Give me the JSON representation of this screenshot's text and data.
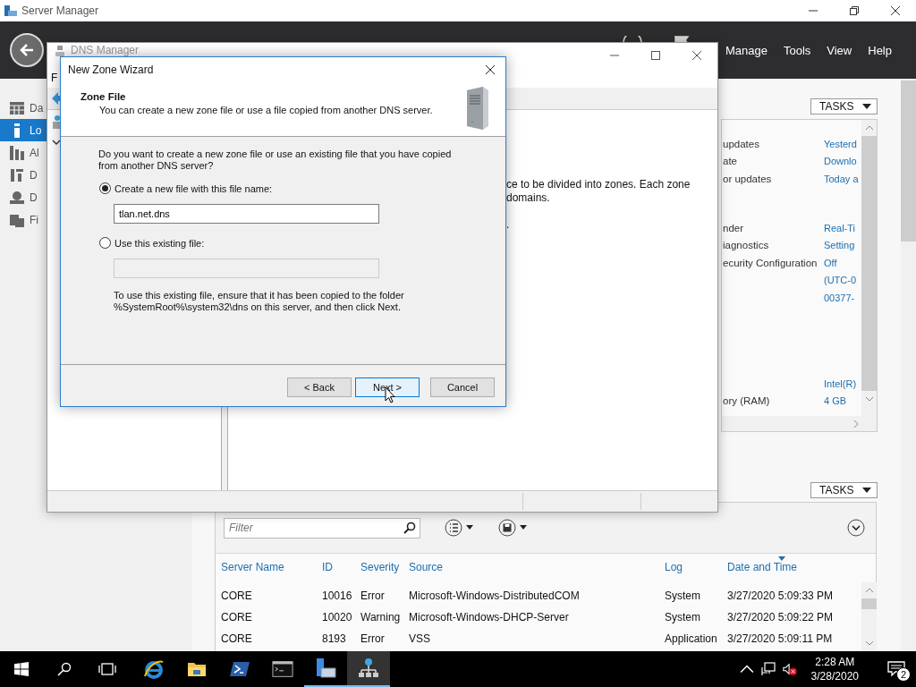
{
  "server_manager": {
    "title": "Server Manager",
    "menu": [
      "Manage",
      "Tools",
      "View",
      "Help"
    ],
    "nav": [
      {
        "kind": "dashboard",
        "label": "Da",
        "selected": false
      },
      {
        "kind": "local",
        "label": "Lo",
        "selected": true
      },
      {
        "kind": "all",
        "label": "Al",
        "selected": false
      },
      {
        "kind": "dhcp",
        "label": "D",
        "selected": false
      },
      {
        "kind": "dns",
        "label": "D",
        "selected": false
      },
      {
        "kind": "files",
        "label": "Fi",
        "selected": false
      }
    ],
    "properties": {
      "tasks_label": "TASKS",
      "groups": [
        [
          {
            "label": "updates",
            "value": "Yesterd"
          },
          {
            "label": "ate",
            "value": "Downlo"
          },
          {
            "label": "or updates",
            "value": "Today a"
          }
        ],
        [
          {
            "label": "nder",
            "value": "Real-Ti"
          },
          {
            "label": "iagnostics",
            "value": "Setting"
          },
          {
            "label": "ecurity Configuration",
            "value": "Off"
          },
          {
            "value": "(UTC-0"
          },
          {
            "value": "00377-"
          }
        ],
        [
          {
            "value": "Intel(R)"
          },
          {
            "label": "ory (RAM)",
            "value": "4 GB"
          }
        ]
      ]
    },
    "events": {
      "tasks_label": "TASKS",
      "filter_placeholder": "Filter",
      "columns": [
        {
          "label": "Server Name",
          "sorted": false
        },
        {
          "label": "ID",
          "sorted": false
        },
        {
          "label": "Severity",
          "sorted": false
        },
        {
          "label": "Source",
          "sorted": false
        },
        {
          "label": "Log",
          "sorted": false
        },
        {
          "label": "Date and Time",
          "sorted": true
        }
      ],
      "rows": [
        [
          "CORE",
          "10016",
          "Error",
          "Microsoft-Windows-DistributedCOM",
          "System",
          "3/27/2020 5:09:33 PM"
        ],
        [
          "CORE",
          "10020",
          "Warning",
          "Microsoft-Windows-DHCP-Server",
          "System",
          "3/27/2020 5:09:22 PM"
        ],
        [
          "CORE",
          "8193",
          "Error",
          "VSS",
          "Application",
          "3/27/2020 5:09:11 PM"
        ]
      ]
    }
  },
  "dns_manager": {
    "title": "DNS Manager",
    "menu_fragment": "F",
    "description_lines": [
      "ce to be divided into zones. Each zone",
      "domains.",
      "."
    ]
  },
  "wizard": {
    "title": "New Zone Wizard",
    "heading": "Zone File",
    "subheading": "You can create a new zone file or use a file copied from another DNS server.",
    "question": "Do you want to create a new zone file or use an existing file that you have copied from another DNS server?",
    "options": [
      {
        "label": "Create a new file with this file name:",
        "selected": true,
        "field": {
          "value": "tlan.net.dns",
          "disabled": false
        }
      },
      {
        "label": "Use this existing file:",
        "selected": false,
        "field": {
          "disabled": true
        }
      }
    ],
    "note": "To use this existing file, ensure that it has been copied to the folder %SystemRoot%\\system32\\dns on this server, and then click Next.",
    "buttons": [
      {
        "label": "< Back",
        "focused": false
      },
      {
        "label": "Next >",
        "focused": true
      },
      {
        "label": "Cancel",
        "focused": false
      }
    ]
  },
  "taskbar": {
    "apps": [
      {
        "kind": "browser",
        "running": false,
        "selected": false
      },
      {
        "kind": "folder",
        "running": false,
        "selected": false
      },
      {
        "kind": "powershell",
        "running": false,
        "selected": false
      },
      {
        "kind": "console",
        "running": false,
        "selected": false
      },
      {
        "kind": "server",
        "running": true,
        "selected": false
      },
      {
        "kind": "network",
        "running": true,
        "selected": true
      }
    ],
    "time": "2:28 AM",
    "date": "3/28/2020",
    "notification_count": "2"
  }
}
